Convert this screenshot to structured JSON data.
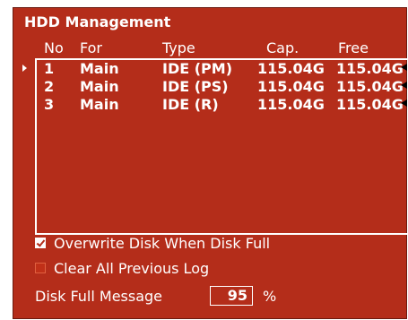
{
  "window": {
    "title": "HDD Management"
  },
  "table": {
    "columns": [
      "No",
      "For",
      "Type",
      "Cap.",
      "Free"
    ],
    "rows": [
      {
        "no": "1",
        "for": "Main",
        "type": "IDE (PM)",
        "cap": "115.04G",
        "free": "115.04G",
        "selected": true
      },
      {
        "no": "2",
        "for": "Main",
        "type": "IDE (PS)",
        "cap": "115.04G",
        "free": "115.04G",
        "selected": false
      },
      {
        "no": "3",
        "for": "Main",
        "type": "IDE (R)",
        "cap": "115.04G",
        "free": "115.04G",
        "selected": false
      }
    ]
  },
  "options": {
    "overwrite": {
      "label": "Overwrite Disk When Disk Full",
      "checked": true
    },
    "clear_log": {
      "label": "Clear All Previous Log",
      "checked": false
    }
  },
  "disk_full": {
    "label": "Disk Full Message",
    "value": "95",
    "unit": "%"
  },
  "colors": {
    "panel": "#b42d1a",
    "text": "#ffffff"
  }
}
